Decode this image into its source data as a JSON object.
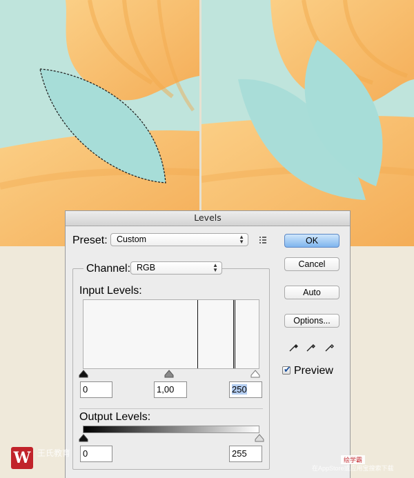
{
  "dialog": {
    "title": "Levels",
    "preset_label": "Preset:",
    "preset_value": "Custom",
    "channel_label": "Channel:",
    "channel_value": "RGB",
    "input_levels_label": "Input Levels:",
    "input_black": "0",
    "input_gamma": "1,00",
    "input_white": "250",
    "output_levels_label": "Output Levels:",
    "output_black": "0",
    "output_white": "255",
    "buttons": {
      "ok": "OK",
      "cancel": "Cancel",
      "auto": "Auto",
      "options": "Options..."
    },
    "preview_label": "Preview",
    "preview_checked": true
  },
  "watermark": {
    "brand": "王氏教育",
    "right_title": "绘学霸",
    "right_sub": "在AppStore或应用宝搜索下载"
  },
  "colors": {
    "teal": "#a7ddd8",
    "orange": "#f6bd6a",
    "cream": "#efe9da",
    "accent_blue": "#7fb5ee"
  }
}
